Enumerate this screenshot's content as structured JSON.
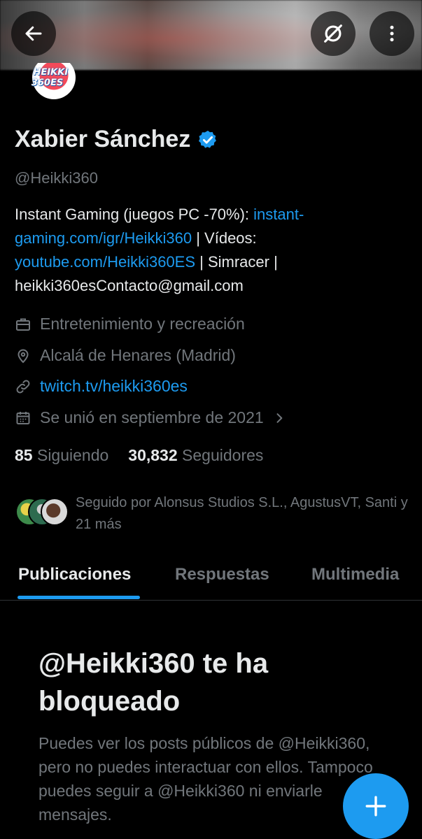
{
  "header": {
    "back_icon": "arrow-left-icon",
    "mute_icon": "slashed-circle-icon",
    "more_icon": "more-vertical-icon"
  },
  "profile": {
    "avatar_text": "HEIKKI 360ES",
    "name": "Xabier Sánchez",
    "verified_icon": "verified-badge-icon",
    "handle": "@Heikki360",
    "bio": {
      "part1": "Instant Gaming (juegos PC -70%): ",
      "link1": "instant-gaming.com/igr/Heikki360",
      "part2": " | Vídeos: ",
      "link2": "youtube.com/Heikki360ES",
      "part3": " | Simracer | heikki360esContacto@gmail.com"
    },
    "category": "Entretenimiento y recreación",
    "location": "Alcalá de Henares (Madrid)",
    "website": "twitch.tv/heikki360es",
    "joined": "Se unió en septiembre de 2021"
  },
  "stats": {
    "following_count": "85",
    "following_label": "Siguiendo",
    "followers_count": "30,832",
    "followers_label": "Seguidores"
  },
  "followed_by": "Seguido por Alonsus Studios S.L., AgustusVT, Santi y 21 más",
  "tabs": [
    {
      "label": "Publicaciones",
      "active": true
    },
    {
      "label": "Respuestas",
      "active": false
    },
    {
      "label": "Multimedia",
      "active": false
    }
  ],
  "blocked": {
    "title": "@Heikki360 te ha bloqueado",
    "body": "Puedes ver los posts públicos de @Heikki360, pero no puedes interactuar con ellos. Tampoco puedes seguir a @Heikki360 ni enviarle mensajes."
  },
  "fab_icon": "plus-icon",
  "colors": {
    "accent": "#1d9bf0",
    "background": "#000000",
    "text_primary": "#e7e9ea",
    "text_secondary": "#71767b"
  }
}
